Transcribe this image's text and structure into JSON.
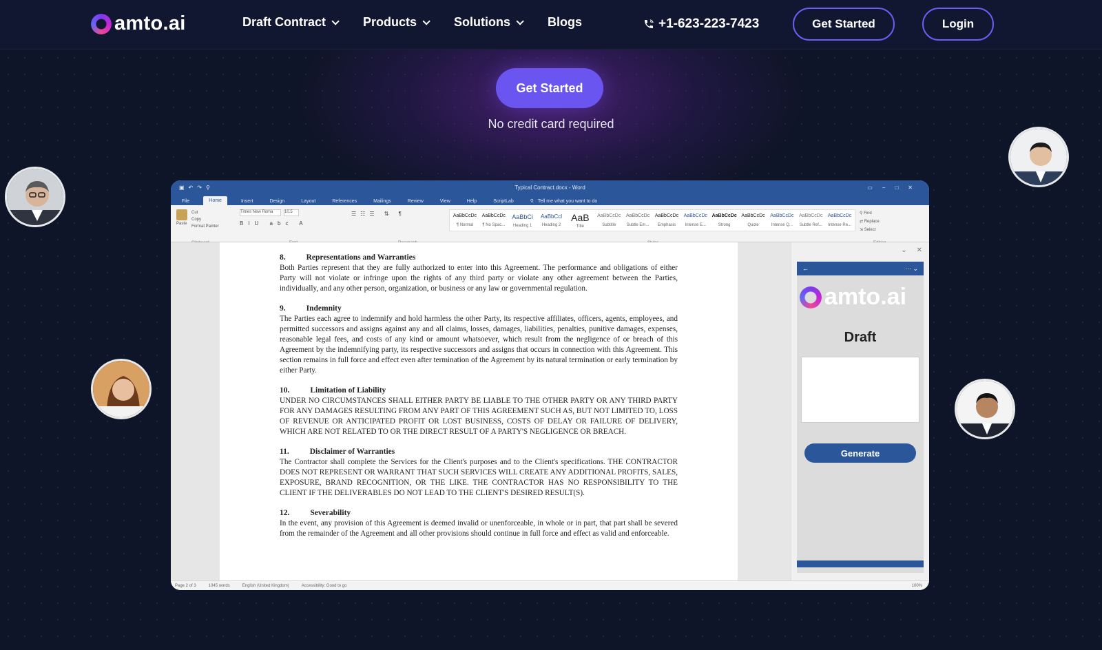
{
  "nav": {
    "logo": "amto.ai",
    "links": [
      "Draft Contract",
      "Products",
      "Solutions",
      "Blogs"
    ],
    "phone": "+1-623-223-7423",
    "get_started": "Get Started",
    "login": "Login"
  },
  "hero": {
    "cta": "Get Started",
    "subtext": "No credit card required"
  },
  "word": {
    "window_title": "Typical Contract.docx - Word",
    "tabs": [
      "File",
      "Home",
      "Insert",
      "Design",
      "Layout",
      "References",
      "Mailings",
      "Review",
      "View",
      "Help",
      "ScriptLab"
    ],
    "tell_me": "Tell me what you want to do",
    "font_name": "Times New Roma",
    "font_size": "10.5",
    "groups": [
      "Clipboard",
      "Font",
      "Paragraph",
      "Styles",
      "Editing"
    ],
    "styles": [
      {
        "sample": "AaBbCcDc",
        "name": "¶ Normal"
      },
      {
        "sample": "AaBbCcDc",
        "name": "¶ No Spac..."
      },
      {
        "sample": "AaBbCi",
        "name": "Heading 1"
      },
      {
        "sample": "AaBbCcl",
        "name": "Heading 2"
      },
      {
        "sample": "AaB",
        "name": "Title"
      },
      {
        "sample": "AaBbCcDc",
        "name": "Subtitle"
      },
      {
        "sample": "AaBbCcDc",
        "name": "Subtle Em..."
      },
      {
        "sample": "AaBbCcDc",
        "name": "Emphasis"
      },
      {
        "sample": "AaBbCcDc",
        "name": "Intense E..."
      },
      {
        "sample": "AaBbCcDc",
        "name": "Strong"
      },
      {
        "sample": "AaBbCcDc",
        "name": "Quote"
      },
      {
        "sample": "AaBbCcDc",
        "name": "Intense Q..."
      },
      {
        "sample": "AaBbCcDc",
        "name": "Subtle Ref..."
      },
      {
        "sample": "AaBbCcDc",
        "name": "Intense Re..."
      }
    ],
    "editing": [
      "Find",
      "Replace",
      "Select"
    ],
    "clipboard": [
      "Paste",
      "Cut",
      "Copy",
      "Format Painter"
    ],
    "status": [
      "Page 2 of 3",
      "1045 words",
      "English (United Kingdom)",
      "Accessibility: Good to go"
    ],
    "zoom": "100%"
  },
  "document": {
    "sections": [
      {
        "num": "8.",
        "title": "Representations and Warranties",
        "text": "Both Parties represent that they are fully authorized to enter into this Agreement. The performance and obligations of either Party will not violate or infringe upon the rights of any third party or violate any other agreement between the Parties, individually, and any other person, organization, or business or any law or governmental regulation."
      },
      {
        "num": "9.",
        "title": "Indemnity",
        "text": "The Parties each agree to indemnify and hold harmless the other Party, its respective affiliates, officers, agents, employees, and permitted successors and assigns against any and all claims, losses, damages, liabilities, penalties, punitive damages, expenses, reasonable legal fees, and costs of any kind or amount whatsoever, which result from the negligence of or breach of this Agreement by the indemnifying party, its respective successors and assigns that occurs in connection with this Agreement. This section remains in full force and effect even after termination of the Agreement by its natural termination or early termination by either Party."
      },
      {
        "num": "10.",
        "title": "Limitation of Liability",
        "text": "UNDER NO CIRCUMSTANCES SHALL EITHER PARTY BE LIABLE TO THE OTHER PARTY OR ANY THIRD PARTY FOR ANY DAMAGES RESULTING FROM ANY PART OF THIS AGREEMENT SUCH AS, BUT NOT LIMITED TO, LOSS OF REVENUE OR ANTICIPATED PROFIT OR LOST BUSINESS, COSTS OF DELAY OR FAILURE OF DELIVERY, WHICH ARE NOT RELATED TO OR THE DIRECT RESULT OF A PARTY'S NEGLIGENCE OR BREACH."
      },
      {
        "num": "11.",
        "title": "Disclaimer of Warranties",
        "text": "The Contractor shall complete the Services for the Client's purposes and to the Client's specifications. THE CONTRACTOR DOES NOT REPRESENT OR WARRANT THAT SUCH SERVICES WILL CREATE ANY ADDITIONAL PROFITS, SALES, EXPOSURE, BRAND RECOGNITION, OR THE LIKE. THE CONTRACTOR HAS NO RESPONSIBILITY TO THE CLIENT IF THE DELIVERABLES DO NOT LEAD TO THE CLIENT'S DESIRED RESULT(S)."
      },
      {
        "num": "12.",
        "title": "Severability",
        "text": "In the event, any provision of this Agreement is deemed invalid or unenforceable, in whole or in part, that part shall be severed from the remainder of the Agreement and all other provisions should continue in full force and effect as valid and enforceable."
      }
    ]
  },
  "addin": {
    "logo": "amto.ai",
    "heading": "Draft",
    "button": "Generate"
  },
  "colors": {
    "background": "#0f1528",
    "accent": "#6a55f0",
    "word_blue": "#2b579a"
  }
}
